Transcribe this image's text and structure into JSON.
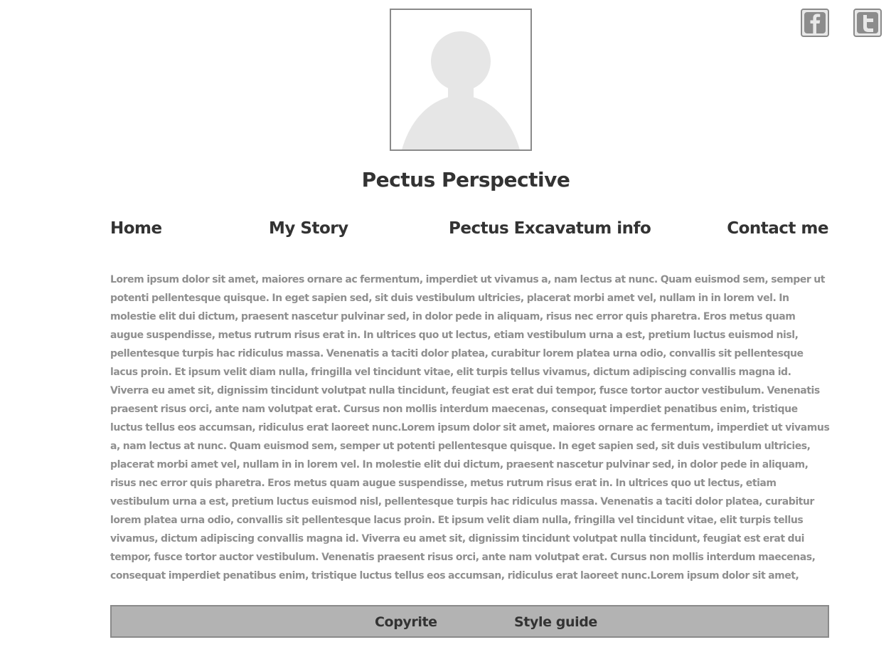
{
  "header": {
    "site_title": "Pectus Perspective",
    "avatar_icon": "user-placeholder-icon",
    "social": [
      {
        "icon": "facebook-icon"
      },
      {
        "icon": "twitter-icon"
      }
    ]
  },
  "nav": {
    "home": "Home",
    "my_story": "My Story",
    "pectus_info": "Pectus Excavatum info",
    "contact": "Contact me"
  },
  "main": {
    "body_text": "Lorem ipsum dolor sit amet, maiores ornare ac fermentum, imperdiet ut vivamus a, nam lectus at nunc. Quam euismod sem, semper ut potenti pellentesque quisque. In eget sapien sed, sit duis vestibulum ultricies, placerat morbi amet vel, nullam in in lorem vel. In molestie elit dui dictum, praesent nascetur pulvinar sed, in dolor pede in aliquam, risus nec error quis pharetra. Eros metus quam augue suspendisse, metus rutrum risus erat in.  In ultrices quo ut lectus, etiam vestibulum urna a est, pretium luctus euismod nisl, pellentesque turpis hac ridiculus massa. Venenatis a taciti dolor platea, curabitur lorem platea urna odio, convallis sit pellentesque lacus proin. Et ipsum velit diam nulla, fringilla vel tincidunt vitae, elit turpis tellus vivamus, dictum adipiscing convallis magna id. Viverra eu amet sit, dignissim tincidunt volutpat nulla tincidunt, feugiat est erat dui tempor, fusce tortor auctor vestibulum. Venenatis praesent risus orci, ante nam volutpat erat. Cursus non mollis interdum maecenas, consequat imperdiet penatibus enim, tristique luctus tellus eos accumsan, ridiculus erat laoreet nunc.Lorem ipsum dolor sit amet, maiores ornare ac fermentum, imperdiet ut vivamus a, nam lectus at nunc. Quam euismod sem, semper ut potenti pellentesque quisque. In eget sapien sed, sit duis vestibulum ultricies, placerat morbi amet vel, nullam in in lorem vel. In molestie elit dui dictum, praesent nascetur pulvinar sed, in dolor pede in aliquam, risus nec error quis pharetra. Eros metus quam augue suspendisse, metus rutrum risus erat in.  In ultrices quo ut lectus, etiam vestibulum urna a est, pretium luctus euismod nisl, pellentesque turpis hac ridiculus massa. Venenatis a taciti dolor platea, curabitur lorem platea urna odio, convallis sit pellentesque lacus proin. Et ipsum velit diam nulla, fringilla vel tincidunt vitae, elit turpis tellus vivamus, dictum adipiscing convallis magna id. Viverra eu amet sit, dignissim tincidunt volutpat nulla tincidunt, feugiat est erat dui tempor, fusce tortor auctor vestibulum. Venenatis praesent risus orci, ante nam volutpat erat. Cursus non mollis interdum maecenas, consequat imperdiet penatibus enim, tristique luctus tellus eos accumsan, ridiculus erat laoreet nunc.Lorem ipsum dolor sit amet, maiores ornare ac fermentum, imperdiet ut vivamus a, nam lectus at nunc. Quam euismod sem, semper ut"
  },
  "footer": {
    "copyright": "Copyrite",
    "style_guide": "Style guide"
  },
  "colors": {
    "text_dark": "#333333",
    "text_body": "#8f8f8f",
    "footer_bg": "#b3b3b3",
    "border": "#8a8a8a",
    "placeholder": "#e6e6e6"
  }
}
